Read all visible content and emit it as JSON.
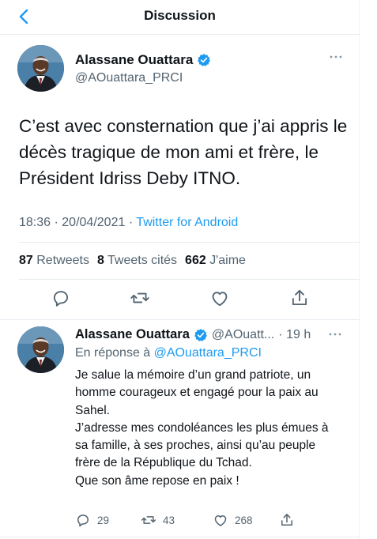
{
  "header": {
    "title": "Discussion"
  },
  "main_tweet": {
    "author_name": "Alassane Ouattara",
    "handle": "@AOuattara_PRCI",
    "text": "C’est avec consternation que j’ai appris le décès tragique de mon ami et frère, le Président Idriss Deby ITNO.",
    "time": "18:36",
    "date": "20/04/2021",
    "separator": "·",
    "source": "Twitter for Android",
    "stats": {
      "retweets_count": "87",
      "retweets_label": "Retweets",
      "quotes_count": "8",
      "quotes_label": "Tweets cités",
      "likes_count": "662",
      "likes_label": "J'aime"
    }
  },
  "reply_tweet": {
    "author_name": "Alassane Ouattara",
    "handle": "@AOuatt...",
    "age": "· 19 h",
    "reply_prefix": "En réponse à",
    "reply_mention": "@AOuattara_PRCI",
    "lines": [
      "Je salue la mémoire d’un grand patriote, un homme courageux et  engagé pour la paix au Sahel.",
      "J’adresse mes condoléances les plus émues à sa famille, à ses proches, ainsi qu’au peuple frère de la République du Tchad.",
      "Que son âme repose en paix !"
    ],
    "replies": "29",
    "retweets": "43",
    "likes": "268"
  },
  "colors": {
    "accent": "#1d9bf0",
    "secondary_text": "#536471",
    "divider": "#e6ecf0"
  },
  "icons": [
    "back-arrow-icon",
    "verified-badge-icon",
    "more-options-icon",
    "reply-icon",
    "retweet-icon",
    "like-icon",
    "share-icon"
  ]
}
